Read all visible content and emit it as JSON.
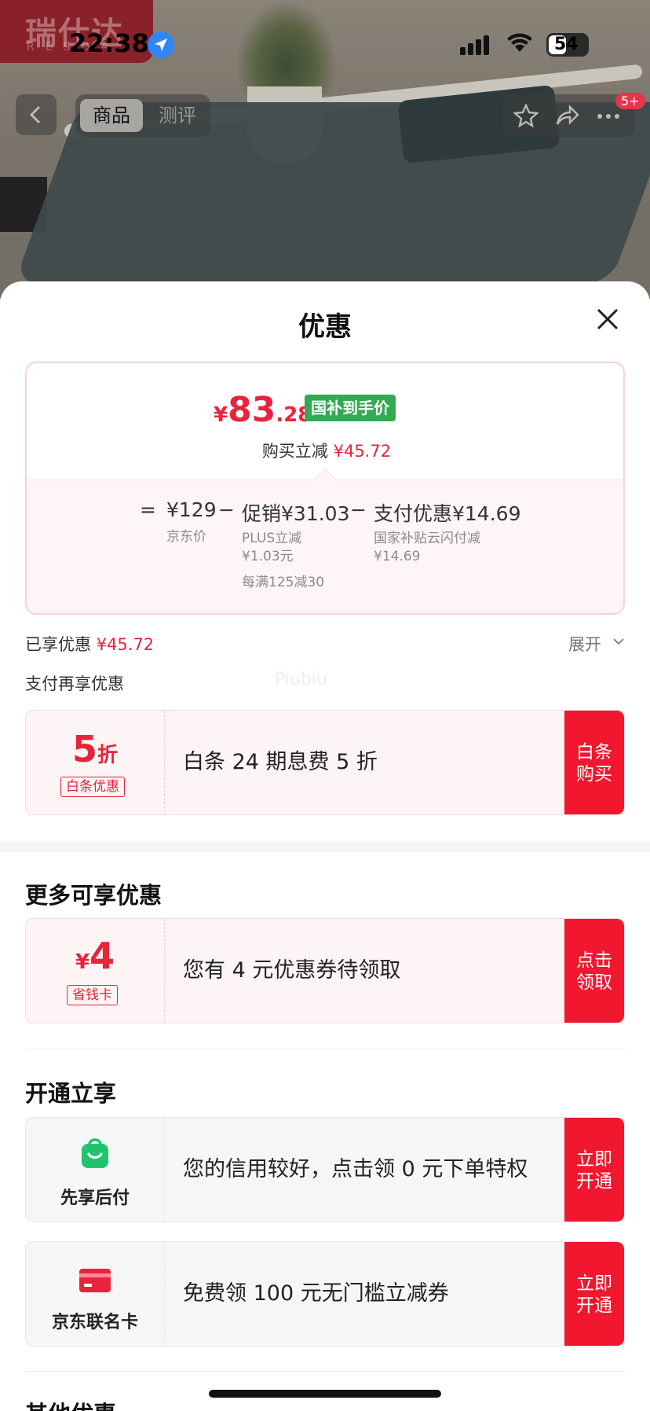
{
  "status_bar": {
    "time": "22:38",
    "battery": "54"
  },
  "background": {
    "brand": "瑞仕达",
    "brand_sub": "RESDA"
  },
  "nav": {
    "tab_product": "商品",
    "tab_review": "测评",
    "badge": "5+"
  },
  "sheet": {
    "title": "优惠",
    "price_card": {
      "currency": "¥",
      "price_int": "83",
      "price_dec": ".28",
      "gov_tag": "国补到手价",
      "instant_label": "购买立减",
      "instant_value": "¥45.72",
      "equals": "=",
      "jd_price": "¥129",
      "jd_price_label": "京东价",
      "minus1": "−",
      "promo": "促销¥31.03",
      "promo_note1": "PLUS立减",
      "promo_note2": "¥1.03元",
      "promo_note3": "每满125减30",
      "minus2": "−",
      "pay_discount": "支付优惠¥14.69",
      "pay_note1": "国家补贴云闪付减",
      "pay_note2": "¥14.69"
    },
    "enjoyed_label": "已享优惠",
    "enjoyed_value": "¥45.72",
    "expand_label": "展开",
    "pay_more_label": "支付再享优惠",
    "watermark": "Piubiu",
    "baitiao": {
      "big": "5",
      "unit": "折",
      "tag": "白条优惠",
      "desc": "白条 24 期息费 5 折",
      "cta": "白条购买"
    },
    "more_title": "更多可享优惠",
    "coupon": {
      "sym": "¥",
      "big": "4",
      "tag": "省钱卡",
      "desc": "您有 4 元优惠券待领取",
      "cta": "点击领取"
    },
    "open_title": "开通立享",
    "xianxiang": {
      "label": "先享后付",
      "desc": "您的信用较好，点击领 0 元下单特权",
      "cta": "立即开通"
    },
    "card": {
      "label": "京东联名卡",
      "desc": "免费领 100 元无门槛立减券",
      "cta": "立即开通"
    },
    "other_title": "其他优惠"
  },
  "colors": {
    "accent": "#f0172e",
    "price_red": "#e8243a",
    "gov_green": "#34a853"
  }
}
